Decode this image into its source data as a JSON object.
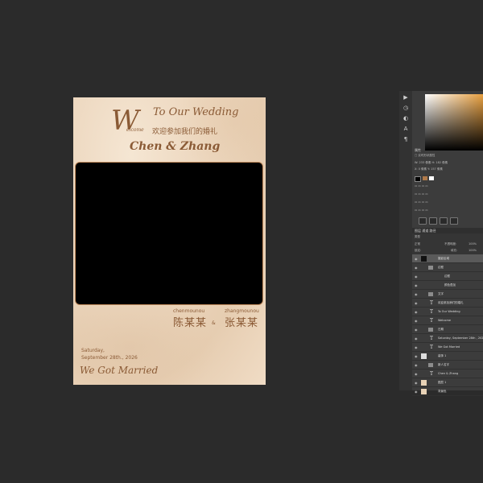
{
  "card": {
    "welcome_initial": "W",
    "welcome_rest": "elcome",
    "to_our_wedding": "To Our Wedding",
    "chinese_welcome": "欢迎参加我们的婚礼",
    "couple": "Chen & Zhang",
    "groom_pinyin": "chenmounou",
    "bride_pinyin": "zhangmounou",
    "groom_name": "陈某某",
    "ampersand": "&",
    "bride_name": "张某某",
    "day": "Saturday,",
    "date": "September 28th., 2026",
    "married": "We Got Married"
  },
  "layers_panel": {
    "tabs": "图层  通道  路径",
    "kind": "类型",
    "blend": "正常",
    "opacity_label": "不透明度:",
    "opacity": "100%",
    "lock_label": "锁定:",
    "fill_label": "填充:",
    "fill": "100%",
    "layers": [
      {
        "name": "摄影区域",
        "type": "image",
        "selected": true
      },
      {
        "name": "边框",
        "type": "group"
      },
      {
        "name": "边框",
        "type": "sub"
      },
      {
        "name": "颜色叠加",
        "type": "sub"
      },
      {
        "name": "文字",
        "type": "group"
      },
      {
        "name": "欢迎参加我们的婚礼",
        "type": "text"
      },
      {
        "name": "To Our Wedding",
        "type": "text"
      },
      {
        "name": "Welcome",
        "type": "text"
      },
      {
        "name": "日期",
        "type": "group"
      },
      {
        "name": "Saturday, September 28th , 2026",
        "type": "text"
      },
      {
        "name": "We Got Married",
        "type": "text"
      },
      {
        "name": "装饰 1",
        "type": "image"
      },
      {
        "name": "新人名字",
        "type": "group"
      },
      {
        "name": "Chen & Zhang",
        "type": "text"
      },
      {
        "name": "图层 1",
        "type": "fill"
      },
      {
        "name": "背景色",
        "type": "fill"
      }
    ]
  },
  "properties_panel": {
    "title": "属性",
    "rows": [
      "□ 实时形状属性",
      "W: 233 像素   H: 182 像素",
      "X: 0 像素     Y: 157 像素"
    ],
    "colors": [
      "#000000",
      "#b07a4a",
      "#ffffff"
    ]
  },
  "colors": {
    "accent": "#8a5a35",
    "background": "#2b2b2b",
    "panel": "#3c3c3c"
  }
}
